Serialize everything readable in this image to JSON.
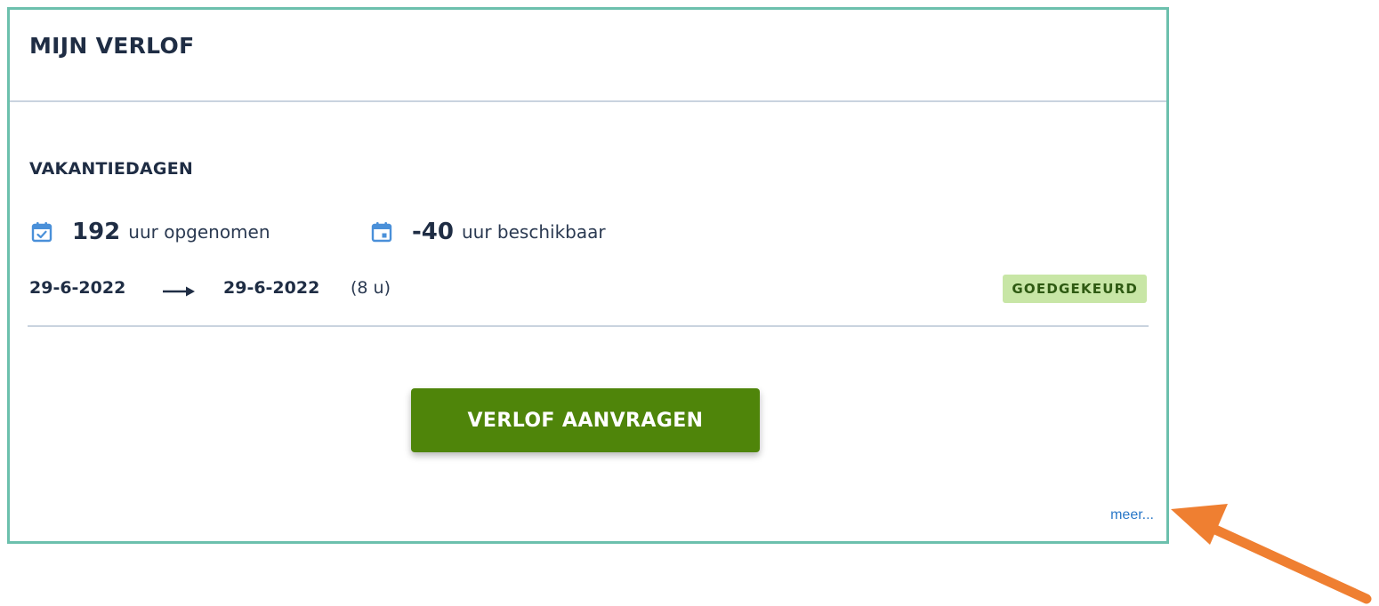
{
  "card": {
    "title": "MIJN VERLOF",
    "section_title": "VAKANTIEDAGEN",
    "taken": {
      "icon": "calendar-check-icon",
      "value": "192",
      "label": "uur opgenomen"
    },
    "available": {
      "icon": "calendar-event-icon",
      "value": "-40",
      "label": "uur beschikbaar"
    },
    "leave_entry": {
      "start_date": "29-6-2022",
      "end_date": "29-6-2022",
      "duration": "(8 u)",
      "status": "GOEDGEKEURD",
      "status_color": "#c8e6a6"
    },
    "request_button_label": "VERLOF AANVRAGEN",
    "more_link_label": "meer..."
  },
  "colors": {
    "card_border": "#6cc0ad",
    "button": "#4f850a",
    "link": "#2a78c8",
    "icon": "#4a90d9",
    "callout_arrow": "#ef7f31"
  }
}
